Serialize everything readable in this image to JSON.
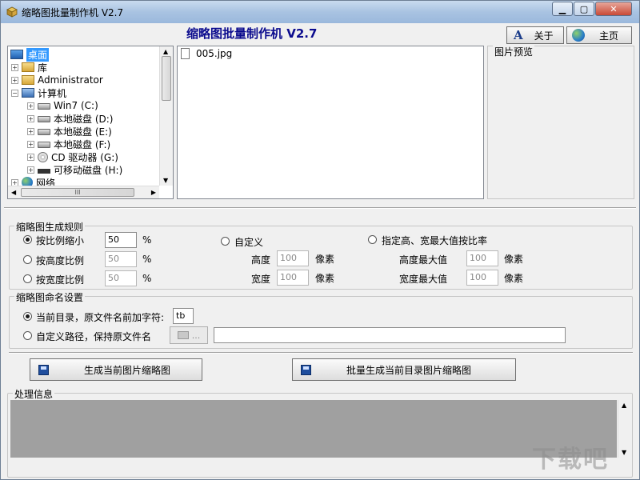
{
  "window": {
    "title": "缩略图批量制作机 V2.7"
  },
  "header": {
    "title": "缩略图批量制作机 V2.7"
  },
  "toolbar": {
    "about_label": "关于",
    "home_label": "主页"
  },
  "tree": {
    "items": [
      {
        "label": "桌面",
        "selected": true
      },
      {
        "label": "库"
      },
      {
        "label": "Administrator"
      },
      {
        "label": "计算机"
      },
      {
        "label": "Win7 (C:)"
      },
      {
        "label": "本地磁盘 (D:)"
      },
      {
        "label": "本地磁盘 (E:)"
      },
      {
        "label": "本地磁盘 (F:)"
      },
      {
        "label": "CD 驱动器 (G:)"
      },
      {
        "label": "可移动磁盘 (H:)"
      },
      {
        "label": "网络"
      }
    ],
    "hscroll_label": "III"
  },
  "files": {
    "items": [
      "005.jpg"
    ]
  },
  "preview": {
    "label": "图片预览"
  },
  "rules": {
    "group_label": "缩略图生成规则",
    "scale_label": "按比例缩小",
    "scale_value": "50",
    "height_ratio_label": "按高度比例",
    "height_ratio_value": "50",
    "width_ratio_label": "按宽度比例",
    "width_ratio_value": "50",
    "percent": "%",
    "custom_label": "自定义",
    "height_label": "高度",
    "height_value": "100",
    "width_label": "宽度",
    "width_value": "100",
    "px_unit": "像素",
    "maxratio_label": "指定高、宽最大值按比率",
    "max_height_label": "高度最大值",
    "max_height_value": "100",
    "max_width_label": "宽度最大值",
    "max_width_value": "100"
  },
  "naming": {
    "group_label": "缩略图命名设置",
    "prefix_label": "当前目录，原文件名前加字符:",
    "prefix_value": "tb",
    "custom_path_label": "自定义路径，保持原文件名",
    "browse_label": "...",
    "path_value": ""
  },
  "actions": {
    "generate_current_label": "生成当前图片缩略图",
    "batch_generate_label": "批量生成当前目录图片缩略图"
  },
  "log": {
    "group_label": "处理信息"
  },
  "watermark": {
    "text": "下载吧"
  },
  "colors": {
    "title_blue": "#0b0b8e",
    "log_bg": "#a0a0a0"
  }
}
